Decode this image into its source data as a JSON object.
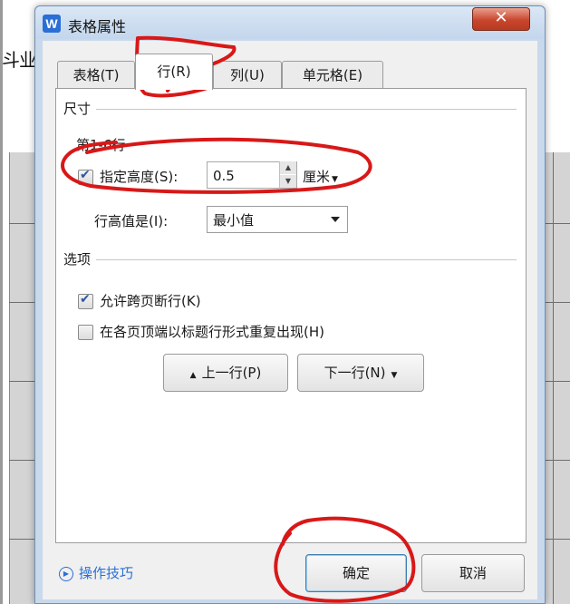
{
  "background_doc": {
    "fragment": "斗业"
  },
  "dialog": {
    "title": "表格属性",
    "app_icon": "W",
    "close_glyph": "✕",
    "tabs": [
      "表格(T)",
      "行(R)",
      "列(U)",
      "单元格(E)"
    ],
    "active_tab": "行(R)",
    "size_section": {
      "label": "尺寸",
      "row_range": "第1-6行",
      "specify_height": {
        "label": "指定高度(S):",
        "checked": true,
        "value": "0.5",
        "unit": "厘米"
      },
      "row_height_is": {
        "label": "行高值是(I):",
        "value": "最小值"
      }
    },
    "options_section": {
      "label": "选项",
      "allow_break": {
        "label": "允许跨页断行(K)",
        "checked": true
      },
      "repeat_header": {
        "label": "在各页顶端以标题行形式重复出现(H)",
        "checked": false
      }
    },
    "prev_row_button": "上一行(P)",
    "next_row_button": "下一行(N)",
    "tips_link": "操作技巧",
    "ok_button": "确定",
    "cancel_button": "取消"
  },
  "annotation_color": "#d81818",
  "colors": {
    "accent": "#2a6fd6",
    "close": "#c9462d"
  }
}
